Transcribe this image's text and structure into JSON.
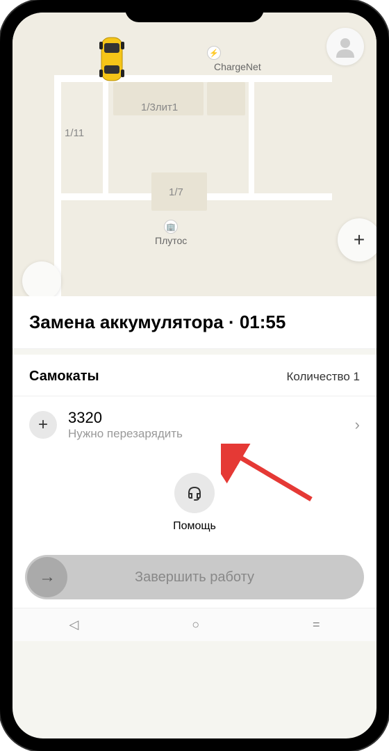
{
  "map": {
    "poi_chargenet": "ChargeNet",
    "poi_plutos": "Плутос",
    "addr_1": "1/3лит1",
    "addr_2": "1/11",
    "addr_3": "1/7"
  },
  "header": {
    "title": "Замена аккумулятора · 01:55"
  },
  "section": {
    "title": "Самокаты",
    "count_label": "Количество 1"
  },
  "items": [
    {
      "id": "3320",
      "status": "Нужно перезарядить"
    }
  ],
  "help": {
    "label": "Помощь"
  },
  "finish": {
    "label": "Завершить работу"
  }
}
